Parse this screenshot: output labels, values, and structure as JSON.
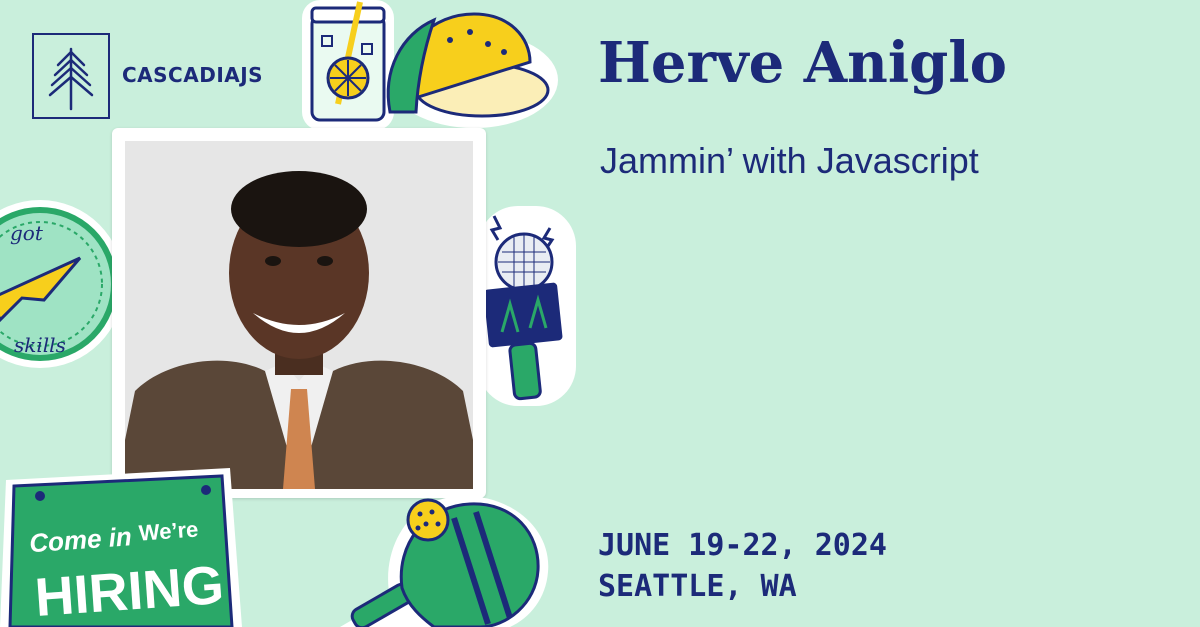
{
  "brand": {
    "name": "CASCADIAJS",
    "logo_icon": "pine-tree-icon"
  },
  "speaker": {
    "name": "Herve Aniglo",
    "talk_title": "Jammin’ with Javascript",
    "photo_icon": "speaker-photo"
  },
  "event": {
    "date": "JUNE 19-22, 2024",
    "location": "SEATTLE, WA"
  },
  "stickers": {
    "badge_top": "got",
    "badge_bottom": "skills",
    "sign_line1": "Come in",
    "sign_line2": "We’re",
    "sign_line3": "HIRING"
  },
  "colors": {
    "background": "#c9efdc",
    "navy": "#1c2a79",
    "green": "#2aa868",
    "yellow": "#f7cf1c"
  }
}
